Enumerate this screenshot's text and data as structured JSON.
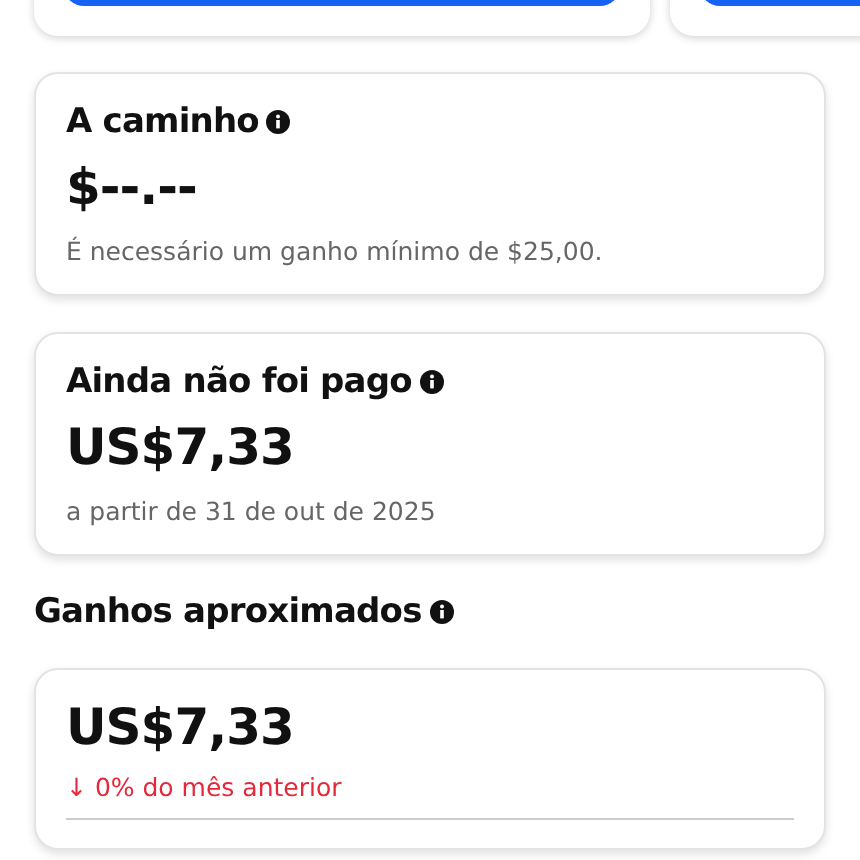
{
  "on_the_way": {
    "title": "A caminho",
    "amount": "$--.--",
    "note": "É necessário um ganho mínimo de $25,00."
  },
  "unpaid": {
    "title": "Ainda não foi pago",
    "amount": "US$7,33",
    "note": "a partir de 31 de out de 2025"
  },
  "approx": {
    "title": "Ganhos aproximados",
    "amount": "US$7,33",
    "change": "↓ 0% do mês anterior"
  }
}
